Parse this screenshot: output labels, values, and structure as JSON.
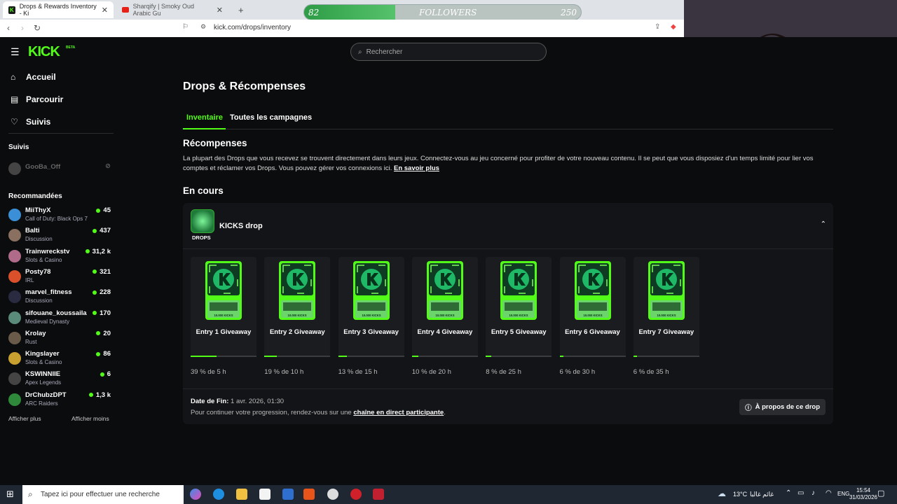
{
  "browser": {
    "tabs": [
      {
        "title": "Drops & Rewards Inventory - Ki"
      },
      {
        "title": "Sharqify | Smoky Oud Arabic Gu"
      }
    ],
    "url": "kick.com/drops/inventory"
  },
  "overlay": {
    "follower_current": "82",
    "follower_label": "FOLLOWERS",
    "follower_goal": "250",
    "follower_progress": 0.33
  },
  "sidebar": {
    "logo": "KICK",
    "logo_badge": "BETA",
    "nav": [
      {
        "label": "Accueil",
        "icon": "home-icon"
      },
      {
        "label": "Parcourir",
        "icon": "browse-icon"
      },
      {
        "label": "Suivis",
        "icon": "heart-icon"
      }
    ],
    "following_title": "Suivis",
    "following": [
      {
        "name": "GooBa_Off"
      }
    ],
    "recommended_title": "Recommandées",
    "recommended": [
      {
        "name": "MiiThyX",
        "category": "Call of Duty: Black Ops 7",
        "viewers": "45",
        "color": "#3a8fd6"
      },
      {
        "name": "Balti",
        "category": "Discussion",
        "viewers": "437",
        "color": "#8a7060"
      },
      {
        "name": "Trainwreckstv",
        "category": "Slots & Casino",
        "viewers": "31,2 k",
        "color": "#b06a8a"
      },
      {
        "name": "Posty78",
        "category": "IRL",
        "viewers": "321",
        "color": "#d9502a"
      },
      {
        "name": "marvel_fitness",
        "category": "Discussion",
        "viewers": "228",
        "color": "#2a2a40"
      },
      {
        "name": "sifouane_koussaila",
        "category": "Medieval Dynasty",
        "viewers": "170",
        "color": "#5a8a7a"
      },
      {
        "name": "Krolay",
        "category": "Rust",
        "viewers": "20",
        "color": "#6a5a4a"
      },
      {
        "name": "Kingslayer",
        "category": "Slots & Casino",
        "viewers": "86",
        "color": "#c8a030"
      },
      {
        "name": "KSWINNIIE",
        "category": "Apex Legends",
        "viewers": "6",
        "color": "#444"
      },
      {
        "name": "DrChubzDPT",
        "category": "ARC Raiders",
        "viewers": "1,3 k",
        "color": "#2e8a3a"
      }
    ],
    "show_more": "Afficher plus",
    "show_less": "Afficher moins"
  },
  "search": {
    "placeholder": "Rechercher"
  },
  "main": {
    "title": "Drops & Récompenses",
    "tabs": [
      {
        "label": "Inventaire"
      },
      {
        "label": "Toutes les campagnes"
      }
    ],
    "rewards_title": "Récompenses",
    "rewards_desc": "La plupart des Drops que vous recevez se trouvent directement dans leurs jeux. Connectez-vous au jeu concerné pour profiter de votre nouveau contenu. Il se peut que vous disposiez d'un temps limité pour lier vos comptes et réclamer vos Drops. Vous pouvez gérer vos connexions ici.",
    "learn_more": "En savoir plus",
    "in_progress_title": "En cours",
    "drop": {
      "logo_label": "DROPS",
      "title": "KICKS drop",
      "reward_img_text": "10.000 KICKS",
      "rewards": [
        {
          "label": "Entry 1 Giveaway",
          "progress": "39 % de 5 h",
          "pct": 39
        },
        {
          "label": "Entry 2 Giveaway",
          "progress": "19 % de 10 h",
          "pct": 19
        },
        {
          "label": "Entry 3 Giveaway",
          "progress": "13 % de 15 h",
          "pct": 13
        },
        {
          "label": "Entry 4 Giveaway",
          "progress": "10 % de 20 h",
          "pct": 10
        },
        {
          "label": "Entry 5 Giveaway",
          "progress": "8 % de 25 h",
          "pct": 8
        },
        {
          "label": "Entry 6 Giveaway",
          "progress": "6 % de 30 h",
          "pct": 6
        },
        {
          "label": "Entry 7 Giveaway",
          "progress": "6 % de 35 h",
          "pct": 6
        }
      ],
      "end_label": "Date de Fin:",
      "end_value": "1 avr. 2026, 01:30",
      "continue_text": "Pour continuer votre progression, rendez-vous sur une",
      "continue_link": "chaîne en direct participante",
      "about_button": "À propos de ce drop"
    }
  },
  "taskbar": {
    "search_placeholder": "Tapez ici pour effectuer une recherche",
    "weather": "13°C",
    "weather_desc": "غائم غالبا",
    "time": "15:54",
    "date": "31/03/2026"
  },
  "colors": {
    "accent": "#53fc18",
    "background": "#0b0c0e",
    "card": "#131417"
  }
}
